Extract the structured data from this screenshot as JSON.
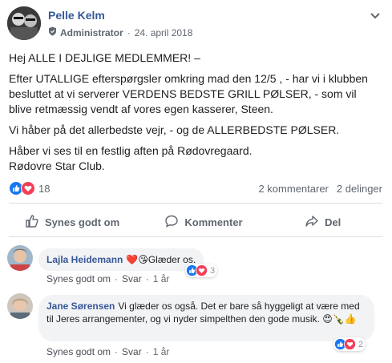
{
  "post": {
    "author": "Pelle Kelm",
    "role": "Administrator",
    "separator": "·",
    "date": "24. april 2018",
    "paragraphs": [
      "Hej ALLE I DEJLIGE MEDLEMMER! –",
      "Efter UTALLIGE efterspørgsler omkring mad den 12/5 , - har vi i klubben besluttet at vi serverer VERDENS BEDSTE GRILL PØLSER, - som vil blive retmæssig vendt af vores egen kasserer, Steen.",
      "Vi håber på det allerbedste vejr, - og de ALLERBEDSTE PØLSER.",
      "Håber vi ses til en festlig aften på Rødovregaard.\nRødovre Star Club."
    ]
  },
  "stats": {
    "reaction_count": "18",
    "comments": "2 kommentarer",
    "shares": "2 delinger"
  },
  "actions": {
    "like": "Synes godt om",
    "comment": "Kommenter",
    "share": "Del"
  },
  "comments": [
    {
      "name": "Lajla Heidemann",
      "emoji_prefix": "❤️😘",
      "text": "Glæder os.",
      "like_link": "Synes godt om",
      "reply_link": "Svar",
      "time": "1 år",
      "reaction_count": "3"
    },
    {
      "name": "Jane Sørensen",
      "text": "Vi glæder os også. Det er bare så hyggeligt at være med til Jeres arrangementer, og vi nyder simpelthen den gode musik.",
      "emoji_suffix": "😍🍾👍",
      "like_link": "Synes godt om",
      "reply_link": "Svar",
      "time": "1 år",
      "reaction_count": "2"
    }
  ],
  "icons": {
    "like": "like-reaction-icon",
    "love": "love-reaction-icon",
    "thumb": "thumb-up-icon",
    "speech": "comment-bubble-icon",
    "share": "share-arrow-icon",
    "shield": "admin-shield-icon",
    "chevron": "chevron-down-icon"
  },
  "colors": {
    "link": "#365899",
    "like_blue": "#1877f2",
    "love_red": "#f33e58",
    "muted": "#606770",
    "divider": "#dadde1",
    "bubble": "#f2f3f5"
  }
}
